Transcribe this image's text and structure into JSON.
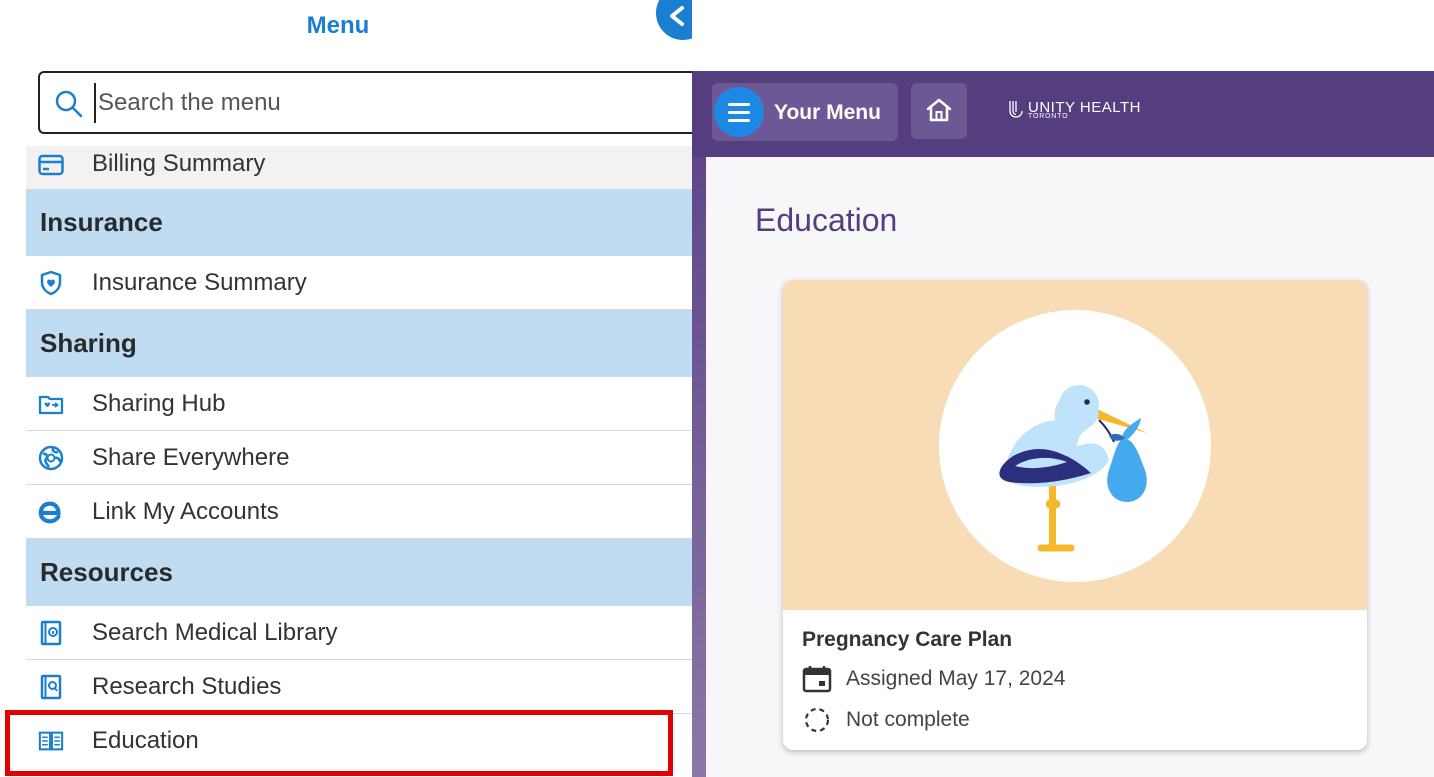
{
  "menu": {
    "title": "Menu",
    "search": {
      "placeholder": "Search the menu",
      "value": ""
    },
    "items": {
      "billing_summary": "Billing Summary",
      "insurance_header": "Insurance",
      "insurance_summary": "Insurance Summary",
      "sharing_header": "Sharing",
      "sharing_hub": "Sharing Hub",
      "share_everywhere": "Share Everywhere",
      "link_my_accounts": "Link My Accounts",
      "resources_header": "Resources",
      "search_medical_library": "Search Medical Library",
      "research_studies": "Research Studies",
      "education": "Education"
    }
  },
  "app": {
    "your_menu_label": "Your Menu",
    "brand_name": "UNITY HEALTH",
    "brand_sub": "TORONTO",
    "page_title": "Education",
    "card": {
      "title": "Pregnancy Care Plan",
      "assigned": "Assigned May 17, 2024",
      "status": "Not complete"
    }
  },
  "colors": {
    "menu_accent": "#1b7fd1",
    "section_header_bg": "#bfdcf3",
    "app_topbar": "#553e80",
    "highlight": "#e20000",
    "card_hero_bg": "#f8dcb6"
  },
  "icons": [
    "back-arrow-icon",
    "search-icon",
    "credit-card-icon",
    "shield-heart-icon",
    "folder-share-icon",
    "globe-share-icon",
    "link-e-icon",
    "library-book-icon",
    "research-book-icon",
    "open-book-icon",
    "hamburger-icon",
    "home-icon",
    "unity-health-logo-icon",
    "stork-illustration-icon",
    "calendar-icon",
    "dashed-circle-icon"
  ]
}
